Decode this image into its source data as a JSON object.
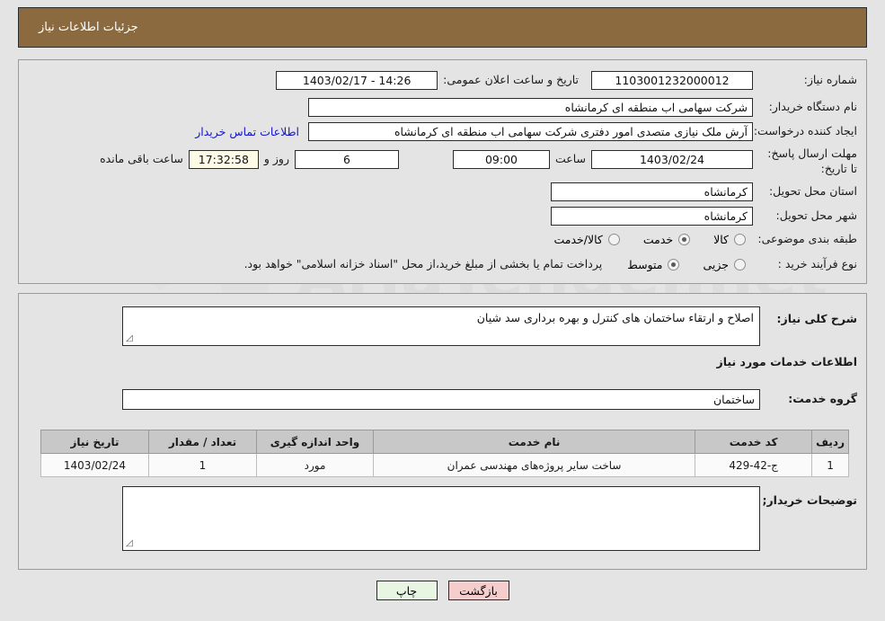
{
  "header": {
    "title": "جزئیات اطلاعات نیاز"
  },
  "colors": {
    "header_bg": "#8b6a3f",
    "page_bg": "#e4e4e4",
    "link": "#1414d2",
    "table_header_bg": "#c8c8c8",
    "back_button_bg": "#f6cdcd",
    "print_button_bg": "#e9f5e3",
    "timer_bg": "#fdfbe8"
  },
  "form": {
    "need_number_label": "شماره نیاز:",
    "need_number_value": "1103001232000012",
    "announce_label": "تاریخ و ساعت اعلان عمومی:",
    "announce_value": "1403/02/17 - 14:26",
    "buyer_org_label": "نام دستگاه خریدار:",
    "buyer_org_value": "شرکت سهامی اب منطقه ای کرمانشاه",
    "requester_label": "ایجاد کننده درخواست:",
    "requester_value": "آرش ملک نیازی متصدی امور دفتری شرکت سهامی اب منطقه ای کرمانشاه",
    "contact_link": "اطلاعات تماس خریدار",
    "deadline_label": "مهلت ارسال پاسخ: تا تاریخ:",
    "deadline_date": "1403/02/24",
    "hour_label": "ساعت",
    "deadline_time": "09:00",
    "days_value": "6",
    "days_label": "روز و",
    "countdown_value": "17:32:58",
    "remaining_label": "ساعت باقی مانده",
    "province_label": "استان محل تحویل:",
    "province_value": "کرمانشاه",
    "city_label": "شهر محل تحویل:",
    "city_value": "کرمانشاه",
    "category_label": "طبقه بندی موضوعی:",
    "category_options": [
      {
        "label": "کالا",
        "selected": false
      },
      {
        "label": "خدمت",
        "selected": true
      },
      {
        "label": "کالا/خدمت",
        "selected": false
      }
    ],
    "process_label": "نوع فرآیند خرید :",
    "process_options": [
      {
        "label": "جزیی",
        "selected": false
      },
      {
        "label": "متوسط",
        "selected": true
      }
    ],
    "process_note": "پرداخت تمام یا بخشی از مبلغ خرید،از محل \"اسناد خزانه اسلامی\" خواهد بود."
  },
  "details": {
    "summary_label": "شرح کلی نیاز:",
    "summary_value": "اصلاح و ارتقاء ساختمان های کنترل و بهره برداری سد شیان",
    "services_heading": "اطلاعات خدمات مورد نیاز",
    "service_group_label": "گروه خدمت:",
    "service_group_value": "ساختمان",
    "buyer_notes_label": "توضیحات خریدار;",
    "buyer_notes_value": ""
  },
  "table": {
    "columns": [
      "ردیف",
      "کد خدمت",
      "نام خدمت",
      "واحد اندازه گیری",
      "تعداد / مقدار",
      "تاریخ نیاز"
    ],
    "rows": [
      [
        "1",
        "ج-42-429",
        "ساخت سایر پروژه‌های مهندسی عمران",
        "مورد",
        "1",
        "1403/02/24"
      ]
    ]
  },
  "footer": {
    "print_label": "چاپ",
    "back_label": "بازگشت"
  }
}
